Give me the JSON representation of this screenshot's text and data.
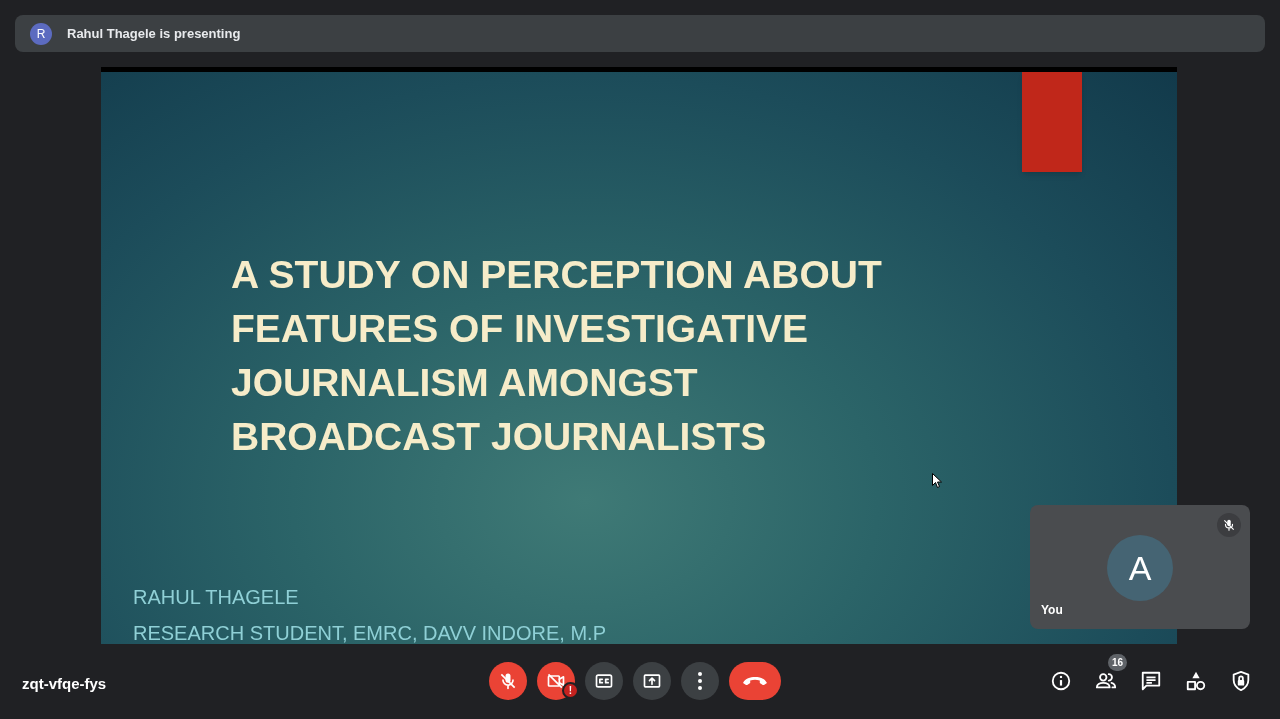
{
  "presenter_bar": {
    "avatar": "R",
    "text": "Rahul Thagele is presenting"
  },
  "slide": {
    "title_lines": [
      "A STUDY ON PERCEPTION ABOUT",
      "FEATURES OF INVESTIGATIVE",
      "JOURNALISM AMONGST",
      "BROADCAST JOURNALISTS"
    ],
    "author": "RAHUL THAGELE",
    "affiliation": "RESEARCH STUDENT, EMRC, DAVV INDORE, M.P"
  },
  "self_tile": {
    "avatar": "A",
    "name": "You",
    "muted": true
  },
  "meeting_code": "zqt-vfqe-fys",
  "controls": {
    "mic": {
      "muted": true
    },
    "camera": {
      "muted": true,
      "warning": "!"
    }
  },
  "side_buttons": [
    {
      "kind": "info"
    },
    {
      "kind": "people",
      "badge": "16"
    },
    {
      "kind": "chat"
    },
    {
      "kind": "activities"
    },
    {
      "kind": "host"
    }
  ]
}
